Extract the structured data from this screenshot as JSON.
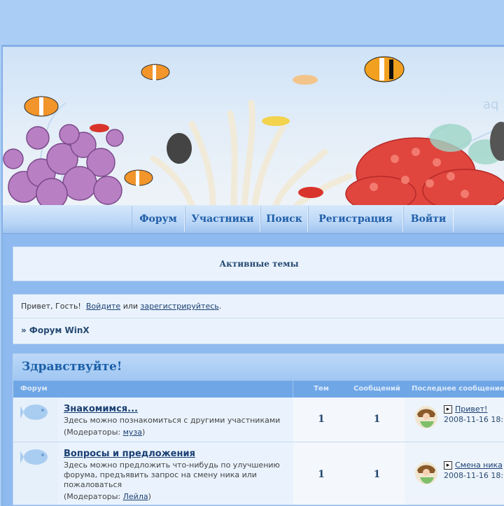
{
  "nav": {
    "items": [
      "Форум",
      "Участники",
      "Поиск",
      "Регистрация",
      "Войти"
    ]
  },
  "active_topics": "Активные темы",
  "greeting": {
    "hello": "Привет, Гость!",
    "login": "Войдите",
    "or": "или",
    "register": "зарегистрируйтесь",
    "dot": "."
  },
  "breadcrumb": "» Форум WinX",
  "category": {
    "title": "Здравствуйте!",
    "headers": {
      "forum": "Форум",
      "topics": "Тем",
      "posts": "Сообщений",
      "last_post": "Последнее сообщение"
    },
    "forums": [
      {
        "name": "Знакомимся...",
        "description": "Здесь можно познакомиться с другими участниками",
        "moderators_label": "(Модераторы:",
        "moderator": "муза",
        "moderators_close": ")",
        "topics": "1",
        "posts": "1",
        "last_title": "Привет!",
        "last_date": "2008-11-16 18:"
      },
      {
        "name": "Вопросы и предложения",
        "description": "Здесь можно предложить что-нибудь по улучшению форума, предъявить запрос на смену ника или пожаловаться",
        "moderators_label": "(Модераторы:",
        "moderator": "Лейла",
        "moderators_close": ")",
        "topics": "1",
        "posts": "1",
        "last_title": "Смена ника",
        "last_date": "2008-11-16 18:"
      }
    ]
  },
  "colors": {
    "accent": "#1f5ea8",
    "background": "#a9cdf5",
    "header_row": "#6fa6e6"
  }
}
